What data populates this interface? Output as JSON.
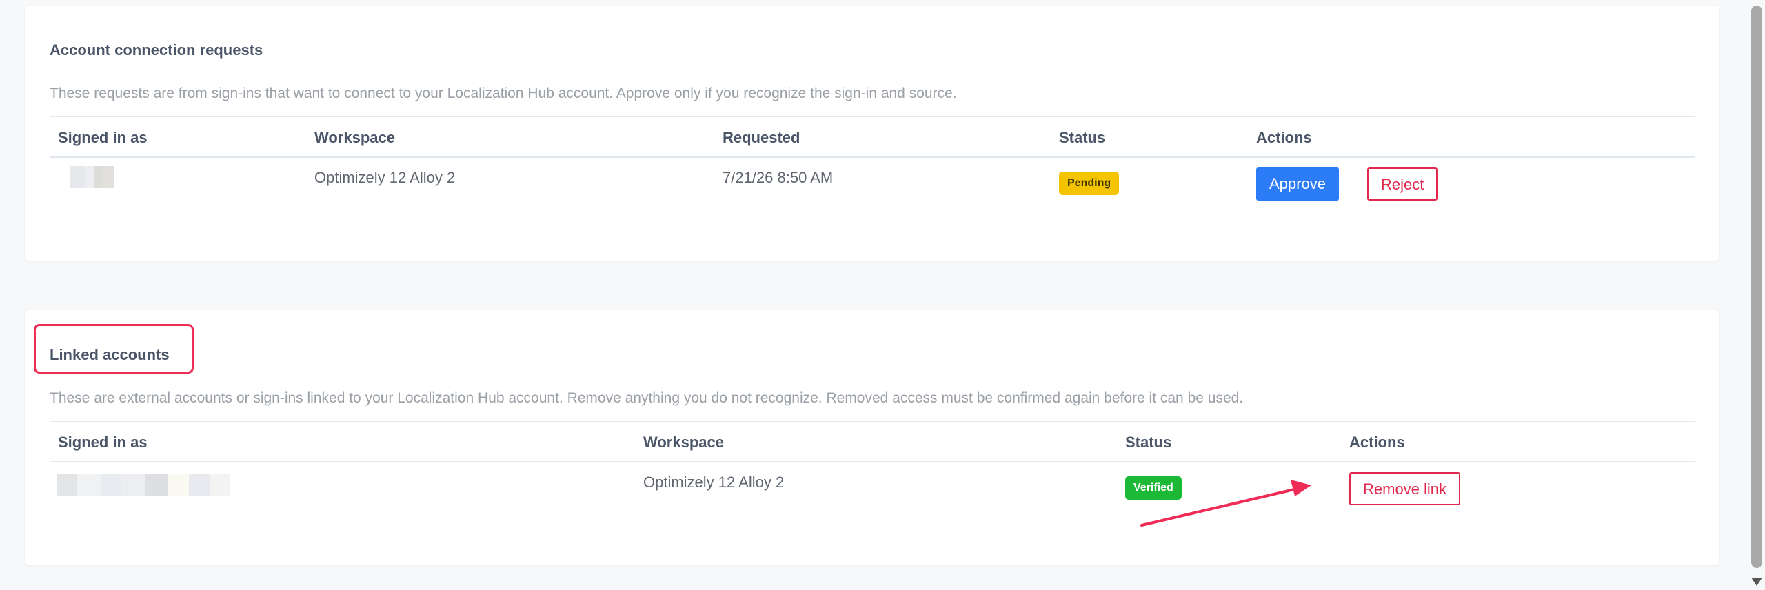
{
  "requests": {
    "title": "Account connection requests",
    "description": "These requests are from sign-ins that want to connect to your Localization Hub account. Approve only if you recognize the sign-in and source.",
    "columns": [
      "Signed in as",
      "Workspace",
      "Requested",
      "Status",
      "Actions"
    ],
    "rows": [
      {
        "workspace": "Optimizely 12 Alloy 2",
        "requested": "7/21/26 8:50 AM",
        "status": "Pending",
        "approve_label": "Approve",
        "reject_label": "Reject"
      }
    ]
  },
  "linked": {
    "title": "Linked accounts",
    "description": "These are external accounts or sign-ins linked to your Localization Hub account. Remove anything you do not recognize. Removed access must be confirmed again before it can be used.",
    "columns": [
      "Signed in as",
      "Workspace",
      "Status",
      "Actions"
    ],
    "rows": [
      {
        "workspace": "Optimizely 12 Alloy 2",
        "status": "Verified",
        "remove_label": "Remove link"
      }
    ]
  },
  "colors": {
    "primary": "#2b7cf6",
    "danger": "#e0294d",
    "pending": "#f5c400",
    "verified": "#1cb936",
    "annotation": "#ee2c55"
  },
  "icons": {
    "annotation_arrow": "arrow-icon",
    "scroll_down": "chevron-down-icon"
  }
}
